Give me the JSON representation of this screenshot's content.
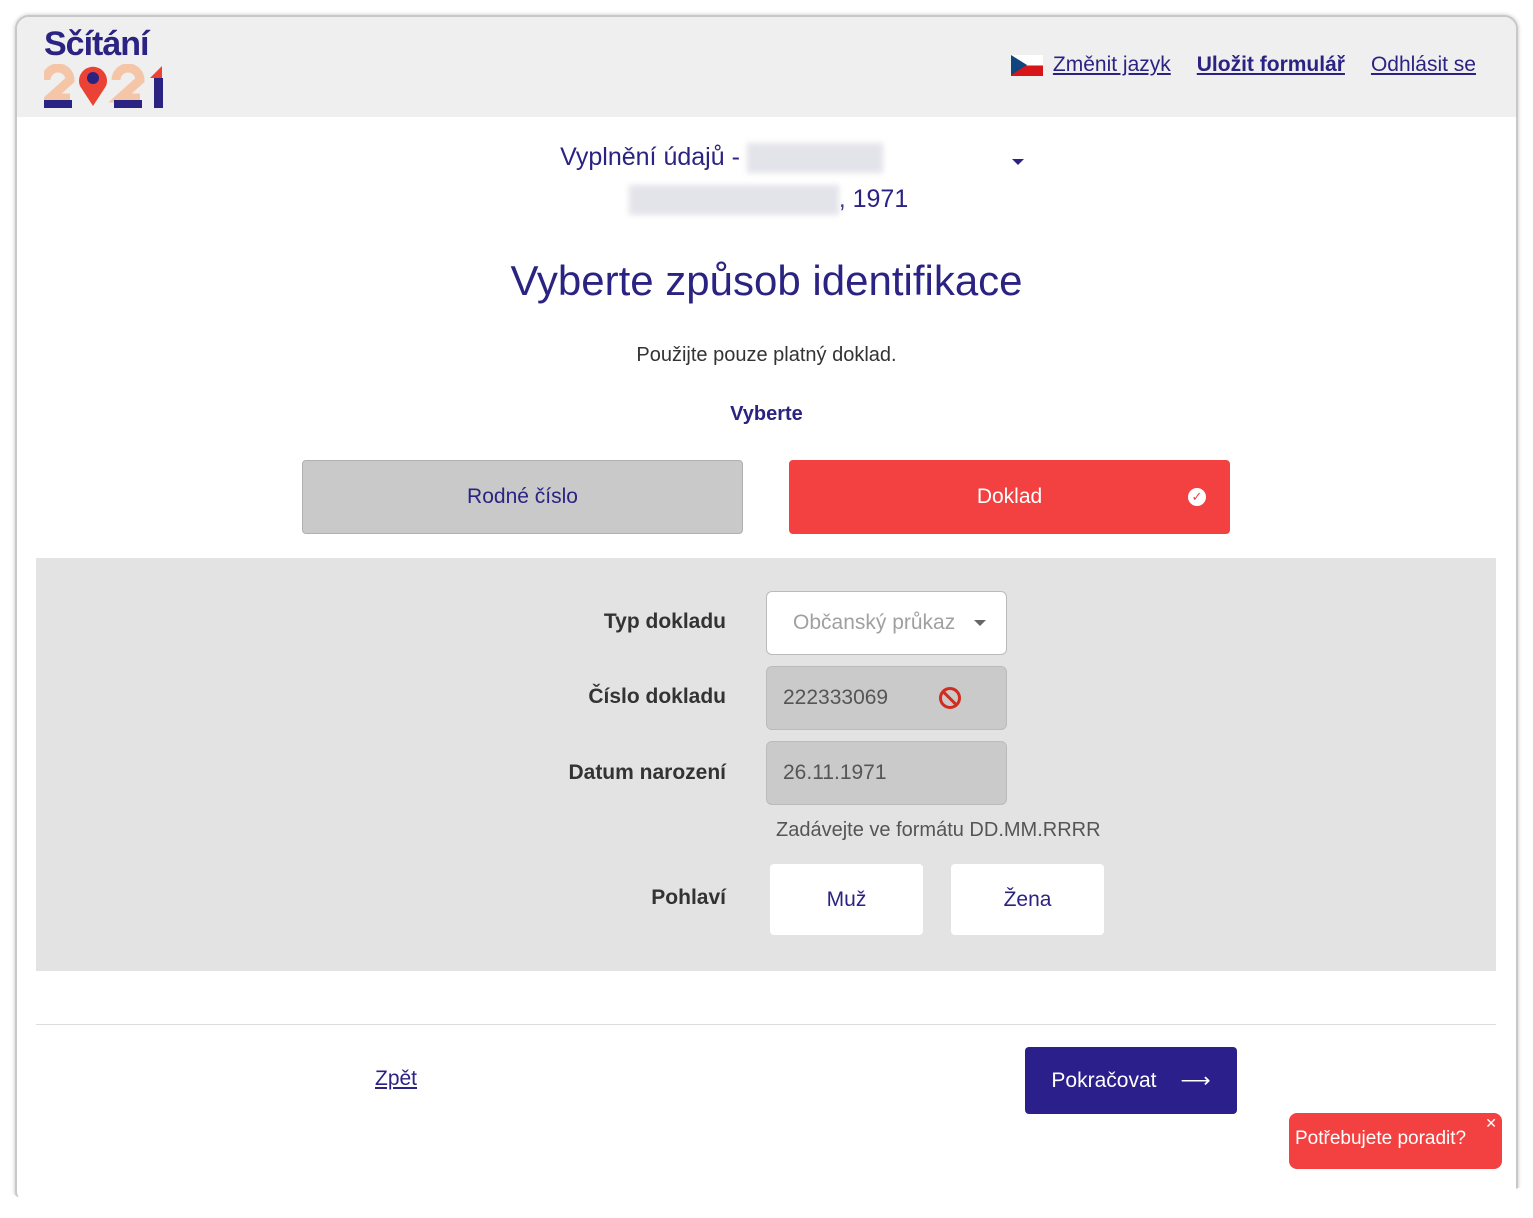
{
  "header": {
    "logo_text": "Sčítání",
    "logo_year": "2021",
    "change_language": "Změnit jazyk",
    "save_form": "Uložit formulář",
    "logout": "Odhlásit se"
  },
  "person": {
    "title_prefix": "Vyplnění údajů -",
    "year_suffix": ", 1971"
  },
  "page": {
    "title": "Vyberte způsob identifikace",
    "subtitle": "Použijte pouze platný doklad.",
    "choose_label": "Vyberte"
  },
  "choices": {
    "birth_number": "Rodné číslo",
    "document": "Doklad"
  },
  "form": {
    "doc_type_label": "Typ dokladu",
    "doc_type_value": "Občanský průkaz",
    "doc_number_label": "Číslo dokladu",
    "doc_number_value": "222333069",
    "birth_date_label": "Datum narození",
    "birth_date_value": "26.11.1971",
    "date_hint": "Zadávejte ve formátu DD.MM.RRRR",
    "gender_label": "Pohlaví",
    "gender_male": "Muž",
    "gender_female": "Žena"
  },
  "footer": {
    "back": "Zpět",
    "continue": "Pokračovat",
    "help": "Potřebujete poradit?"
  },
  "colors": {
    "primary": "#2b2382",
    "accent": "#f34040"
  }
}
